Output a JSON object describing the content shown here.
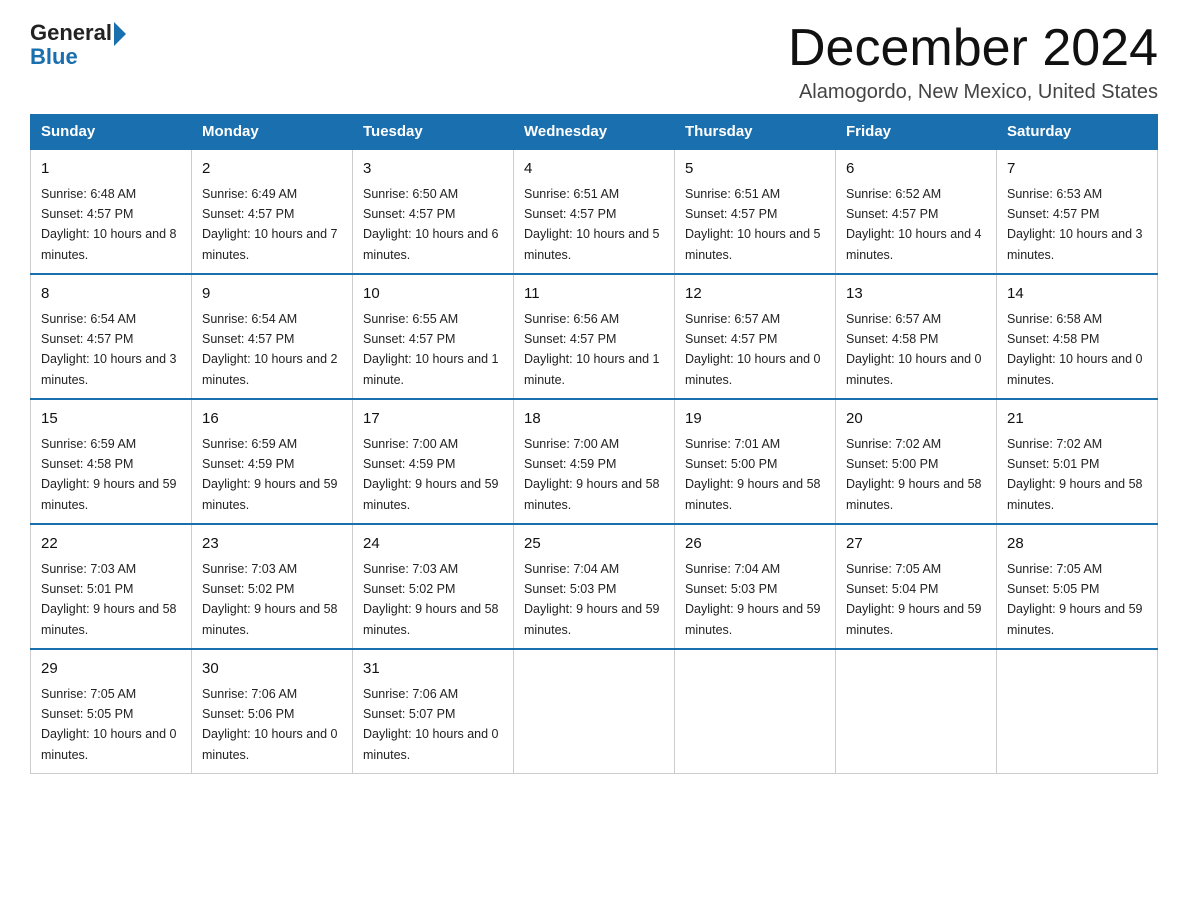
{
  "header": {
    "logo_general": "General",
    "logo_blue": "Blue",
    "month_title": "December 2024",
    "location": "Alamogordo, New Mexico, United States"
  },
  "weekdays": [
    "Sunday",
    "Monday",
    "Tuesday",
    "Wednesday",
    "Thursday",
    "Friday",
    "Saturday"
  ],
  "weeks": [
    [
      {
        "day": "1",
        "sunrise": "6:48 AM",
        "sunset": "4:57 PM",
        "daylight": "10 hours and 8 minutes."
      },
      {
        "day": "2",
        "sunrise": "6:49 AM",
        "sunset": "4:57 PM",
        "daylight": "10 hours and 7 minutes."
      },
      {
        "day": "3",
        "sunrise": "6:50 AM",
        "sunset": "4:57 PM",
        "daylight": "10 hours and 6 minutes."
      },
      {
        "day": "4",
        "sunrise": "6:51 AM",
        "sunset": "4:57 PM",
        "daylight": "10 hours and 5 minutes."
      },
      {
        "day": "5",
        "sunrise": "6:51 AM",
        "sunset": "4:57 PM",
        "daylight": "10 hours and 5 minutes."
      },
      {
        "day": "6",
        "sunrise": "6:52 AM",
        "sunset": "4:57 PM",
        "daylight": "10 hours and 4 minutes."
      },
      {
        "day": "7",
        "sunrise": "6:53 AM",
        "sunset": "4:57 PM",
        "daylight": "10 hours and 3 minutes."
      }
    ],
    [
      {
        "day": "8",
        "sunrise": "6:54 AM",
        "sunset": "4:57 PM",
        "daylight": "10 hours and 3 minutes."
      },
      {
        "day": "9",
        "sunrise": "6:54 AM",
        "sunset": "4:57 PM",
        "daylight": "10 hours and 2 minutes."
      },
      {
        "day": "10",
        "sunrise": "6:55 AM",
        "sunset": "4:57 PM",
        "daylight": "10 hours and 1 minute."
      },
      {
        "day": "11",
        "sunrise": "6:56 AM",
        "sunset": "4:57 PM",
        "daylight": "10 hours and 1 minute."
      },
      {
        "day": "12",
        "sunrise": "6:57 AM",
        "sunset": "4:57 PM",
        "daylight": "10 hours and 0 minutes."
      },
      {
        "day": "13",
        "sunrise": "6:57 AM",
        "sunset": "4:58 PM",
        "daylight": "10 hours and 0 minutes."
      },
      {
        "day": "14",
        "sunrise": "6:58 AM",
        "sunset": "4:58 PM",
        "daylight": "10 hours and 0 minutes."
      }
    ],
    [
      {
        "day": "15",
        "sunrise": "6:59 AM",
        "sunset": "4:58 PM",
        "daylight": "9 hours and 59 minutes."
      },
      {
        "day": "16",
        "sunrise": "6:59 AM",
        "sunset": "4:59 PM",
        "daylight": "9 hours and 59 minutes."
      },
      {
        "day": "17",
        "sunrise": "7:00 AM",
        "sunset": "4:59 PM",
        "daylight": "9 hours and 59 minutes."
      },
      {
        "day": "18",
        "sunrise": "7:00 AM",
        "sunset": "4:59 PM",
        "daylight": "9 hours and 58 minutes."
      },
      {
        "day": "19",
        "sunrise": "7:01 AM",
        "sunset": "5:00 PM",
        "daylight": "9 hours and 58 minutes."
      },
      {
        "day": "20",
        "sunrise": "7:02 AM",
        "sunset": "5:00 PM",
        "daylight": "9 hours and 58 minutes."
      },
      {
        "day": "21",
        "sunrise": "7:02 AM",
        "sunset": "5:01 PM",
        "daylight": "9 hours and 58 minutes."
      }
    ],
    [
      {
        "day": "22",
        "sunrise": "7:03 AM",
        "sunset": "5:01 PM",
        "daylight": "9 hours and 58 minutes."
      },
      {
        "day": "23",
        "sunrise": "7:03 AM",
        "sunset": "5:02 PM",
        "daylight": "9 hours and 58 minutes."
      },
      {
        "day": "24",
        "sunrise": "7:03 AM",
        "sunset": "5:02 PM",
        "daylight": "9 hours and 58 minutes."
      },
      {
        "day": "25",
        "sunrise": "7:04 AM",
        "sunset": "5:03 PM",
        "daylight": "9 hours and 59 minutes."
      },
      {
        "day": "26",
        "sunrise": "7:04 AM",
        "sunset": "5:03 PM",
        "daylight": "9 hours and 59 minutes."
      },
      {
        "day": "27",
        "sunrise": "7:05 AM",
        "sunset": "5:04 PM",
        "daylight": "9 hours and 59 minutes."
      },
      {
        "day": "28",
        "sunrise": "7:05 AM",
        "sunset": "5:05 PM",
        "daylight": "9 hours and 59 minutes."
      }
    ],
    [
      {
        "day": "29",
        "sunrise": "7:05 AM",
        "sunset": "5:05 PM",
        "daylight": "10 hours and 0 minutes."
      },
      {
        "day": "30",
        "sunrise": "7:06 AM",
        "sunset": "5:06 PM",
        "daylight": "10 hours and 0 minutes."
      },
      {
        "day": "31",
        "sunrise": "7:06 AM",
        "sunset": "5:07 PM",
        "daylight": "10 hours and 0 minutes."
      },
      null,
      null,
      null,
      null
    ]
  ]
}
